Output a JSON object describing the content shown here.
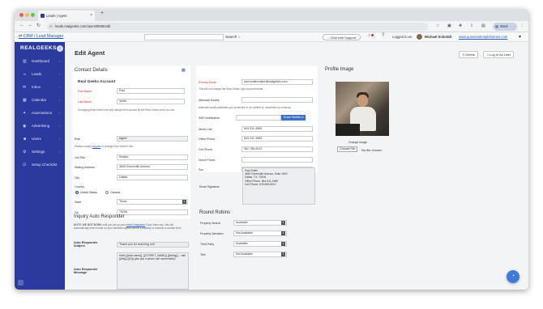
{
  "browser": {
    "tab_title": "Leads | Agent",
    "url": "leads.realgeeks.com/users/8568/edit",
    "profile_label": "Work"
  },
  "header": {
    "crm_link": "CRM / Lead Manager",
    "search_label": "Search",
    "chat_label": "Chat with Support",
    "logged_in_label": "Logged in as",
    "user_name": "Michael Schmidt",
    "website": "www.quinnandemplehomes.com"
  },
  "sidebar": {
    "logo": "REALGEEKS",
    "items": [
      {
        "label": "Dashboard",
        "icon": "dashboard-icon"
      },
      {
        "label": "Leads",
        "icon": "person-icon"
      },
      {
        "label": "Inbox",
        "icon": "inbox-icon"
      },
      {
        "label": "Calendar",
        "icon": "calendar-icon"
      },
      {
        "label": "Automations",
        "icon": "automation-icon"
      },
      {
        "label": "Advertising",
        "icon": "advertising-icon"
      },
      {
        "label": "Users",
        "icon": "users-icon"
      },
      {
        "label": "Settings",
        "icon": "settings-icon"
      },
      {
        "label": "Setup Checklist",
        "icon": "checklist-icon"
      }
    ]
  },
  "page": {
    "title": "Edit Agent",
    "delete_label": "Delete",
    "login_as_label": "Log In As User"
  },
  "contact": {
    "title": "Contact Details",
    "account_title": "Real Geeks Account",
    "first_name_label": "First Name",
    "first_name": "Paul",
    "last_name_label": "Last Name",
    "last_name": "Smith",
    "account_note": "Changing these fields here will change them across all the Real Geeks tools you use.",
    "role_label": "Role",
    "role": "Agent",
    "role_note_pre": "Please contact",
    "role_note_link": "support",
    "role_note_post": "to change Paul Smith's role.",
    "job_title_label": "Job Title",
    "job_title": "Realtor",
    "mailing_label": "Mailing Address",
    "mailing": "4849 Greenville Avenue",
    "city_label": "City",
    "city": "Dallas",
    "country_label": "Country",
    "country_us": "United States",
    "country_ca": "Canada",
    "state_label": "State",
    "state": "Texas",
    "zip_label": "Zip",
    "zip": "75206"
  },
  "email_section": {
    "primary_label": "Primary Email",
    "primary": "paul.smithrealtor@realgeeks.com",
    "primary_note": "This will not change the Real Geeks login account email",
    "alternate_label": "Alternate Emails",
    "alternate_note": "Alternate email addresses you would like to be notified at, separated by commas.",
    "sms_label": "SMS Notification",
    "enter_mobile_label": "Enter Mobile #",
    "direct_label": "Direct Line",
    "direct": "844-311-4969",
    "office_label": "Office Phone",
    "office": "844-311-4969",
    "cell_label": "Cell Phone",
    "cell": "552-786-9012",
    "home_label": "Home Phone",
    "fax_label": "Fax"
  },
  "profile": {
    "title": "Profile Image",
    "change_label": "Change Image",
    "choose_file": "Choose File",
    "no_file": "No file chosen"
  },
  "signature": {
    "label": "Email Signature",
    "lines": [
      "Paul Smith",
      "4849 Greenville Avenue, Suite 1500",
      "Dallas, TX, 75206",
      "Office Phone: 844-311-4969",
      "Cell Phone: 678-555-8012"
    ]
  },
  "round_robins": {
    "title": "Round Robins",
    "rows": [
      {
        "label": "Property Search",
        "value": "Available"
      },
      {
        "label": "Property Valuation",
        "value": "Not Available"
      },
      {
        "label": "Third Party",
        "value": "Available"
      },
      {
        "label": "Text",
        "value": "Not Available"
      }
    ]
  },
  "inquiry": {
    "title": "Inquiry Auto Responder",
    "note_bold": "NOTE: WE NOT WORK",
    "note_pre": "until you set up your",
    "note_link": "email integration",
    "note_post": "If you have one, this will automatically enter a lead on your website inquires about a property or submits a contact form.",
    "subject_label": "Auto Responder Subject",
    "subject": "Thank you for reaching out!",
    "message_label": "Auto Responder Message",
    "message": "Hello {{lead.name}}, {{STREET_NAME}} {{listing}}... visit {{link}} {{ID}} give you a phone call momentarily!"
  },
  "colors": {
    "sidebar": "#2b3a9c",
    "accent": "#3d6fc4",
    "link": "#2a5db0"
  }
}
